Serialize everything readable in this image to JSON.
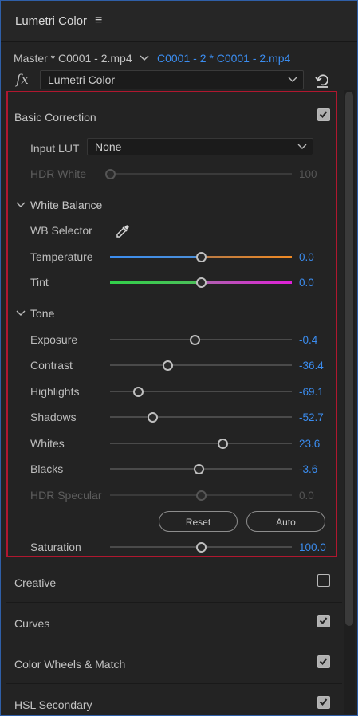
{
  "panel": {
    "title": "Lumetri Color",
    "menu_glyph": "≡"
  },
  "clip": {
    "master": "Master * C0001 - 2.mp4",
    "sequence_clip": "C0001 - 2 * C0001 - 2.mp4"
  },
  "effect": {
    "fx_label": "fx",
    "selected": "Lumetri Color"
  },
  "basic_correction": {
    "title": "Basic Correction",
    "enabled": true,
    "input_lut": {
      "label": "Input LUT",
      "value": "None"
    },
    "hdr_white": {
      "label": "HDR White",
      "value": "100",
      "enabled": false,
      "fraction": 0.0
    },
    "white_balance": {
      "title": "White Balance",
      "wb_selector_label": "WB Selector",
      "temperature": {
        "label": "Temperature",
        "value": "0.0",
        "fraction": 0.5
      },
      "tint": {
        "label": "Tint",
        "value": "0.0",
        "fraction": 0.5
      }
    },
    "tone": {
      "title": "Tone",
      "exposure": {
        "label": "Exposure",
        "value": "-0.4",
        "fraction": 0.465
      },
      "contrast": {
        "label": "Contrast",
        "value": "-36.4",
        "fraction": 0.32
      },
      "highlights": {
        "label": "Highlights",
        "value": "-69.1",
        "fraction": 0.155
      },
      "shadows": {
        "label": "Shadows",
        "value": "-52.7",
        "fraction": 0.235
      },
      "whites": {
        "label": "Whites",
        "value": "23.6",
        "fraction": 0.62
      },
      "blacks": {
        "label": "Blacks",
        "value": "-3.6",
        "fraction": 0.49
      },
      "hdr_specular": {
        "label": "HDR Specular",
        "value": "0.0",
        "enabled": false,
        "fraction": 0.5
      }
    },
    "buttons": {
      "reset": "Reset",
      "auto": "Auto"
    },
    "saturation": {
      "label": "Saturation",
      "value": "100.0",
      "fraction": 0.5
    }
  },
  "sections": [
    {
      "title": "Creative",
      "enabled": false
    },
    {
      "title": "Curves",
      "enabled": true
    },
    {
      "title": "Color Wheels & Match",
      "enabled": true
    },
    {
      "title": "HSL Secondary",
      "enabled": true
    }
  ],
  "colors": {
    "accent": "#3b8df0",
    "highlight_border": "#b0172f",
    "temperature_gradient": [
      "#3b8df0",
      "#f08a24"
    ],
    "tint_gradient": [
      "#32d04a",
      "#e020d8"
    ]
  }
}
